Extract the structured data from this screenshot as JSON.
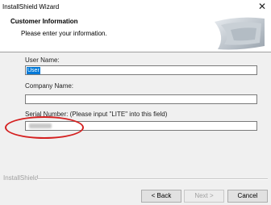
{
  "window": {
    "title": "InstallShield Wizard",
    "close_glyph": "✕"
  },
  "header": {
    "title": "Customer Information",
    "subtitle": "Please enter your information."
  },
  "form": {
    "user_name_label": "User Name:",
    "user_name_value": "User",
    "company_name_label": "Company Name:",
    "company_name_value": "",
    "serial_label": "Serial Number: (Please input \"LITE\" into this field)",
    "serial_value_obscured": true
  },
  "footer": {
    "brand": "InstallShield",
    "back_label": "< Back",
    "next_label": "Next >",
    "cancel_label": "Cancel"
  },
  "colors": {
    "annotation_circle": "#d42020",
    "selection": "#0078d7"
  }
}
